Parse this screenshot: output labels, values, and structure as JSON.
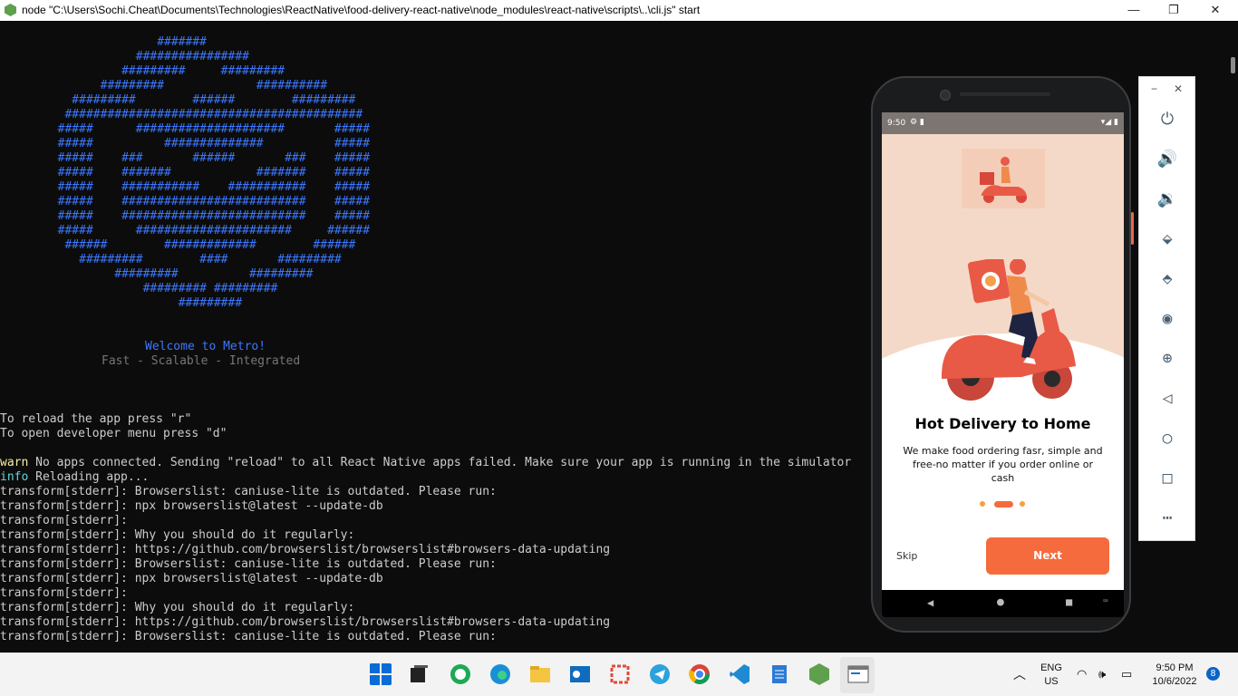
{
  "window": {
    "title": "node  \"C:\\Users\\Sochi.Cheat\\Documents\\Technologies\\ReactNative\\food-delivery-react-native\\node_modules\\react-native\\scripts\\..\\cli.js\" start",
    "minimize": "—",
    "restore": "❐",
    "close": "✕"
  },
  "console": {
    "ascii_art": "                #######\n             ################\n           #########     #########\n        #########             ##########\n    #########        ######        #########\n   ##########################################\n  #####      #####################       #####\n  #####          ##############          #####\n  #####    ###       ######       ###    #####\n  #####    #######            #######    #####\n  #####    ###########    ###########    #####\n  #####    ##########################    #####\n  #####    ##########################    #####\n  #####      ######################     ######\n   ######        #############        ######\n     #########        ####       #########\n          #########          #########\n              ######### #########\n                   #########",
    "welcome": "Welcome to Metro!",
    "tagline": "Fast - Scalable - Integrated",
    "lines": [
      "To reload the app press \"r\"",
      "To open developer menu press \"d\"",
      "",
      "warn No apps connected. Sending \"reload\" to all React Native apps failed. Make sure your app is running in the simulator",
      "info Reloading app...",
      "transform[stderr]: Browserslist: caniuse-lite is outdated. Please run:",
      "transform[stderr]: npx browserslist@latest --update-db",
      "transform[stderr]:",
      "transform[stderr]: Why you should do it regularly:",
      "transform[stderr]: https://github.com/browserslist/browserslist#browsers-data-updating",
      "transform[stderr]: Browserslist: caniuse-lite is outdated. Please run:",
      "transform[stderr]: npx browserslist@latest --update-db",
      "transform[stderr]:",
      "transform[stderr]: Why you should do it regularly:",
      "transform[stderr]: https://github.com/browserslist/browserslist#browsers-data-updating",
      "transform[stderr]: Browserslist: caniuse-lite is outdated. Please run:"
    ],
    "warn_prefix": "warn",
    "warn_rest": " No apps connected. Sending \"reload\" to all React Native apps failed. Make sure your app is running in the simulator",
    "info_prefix": "info",
    "info_rest": " Reloading app..."
  },
  "emulator": {
    "status_time": "9:50",
    "onboarding": {
      "title": "Hot Delivery to Home",
      "description": "We make food ordering fasr, simple and free-no matter if you order online or cash",
      "skip_label": "Skip",
      "next_label": "Next",
      "page_index": 2,
      "page_count": 3
    },
    "panel": {
      "minimize": "−",
      "close": "✕"
    }
  },
  "taskbar": {
    "lang_top": "ENG",
    "lang_bottom": "US",
    "time": "9:50 PM",
    "date": "10/6/2022",
    "notification_count": "8"
  },
  "colors": {
    "accent": "#f56b3d",
    "console_blue": "#3b78ff"
  }
}
